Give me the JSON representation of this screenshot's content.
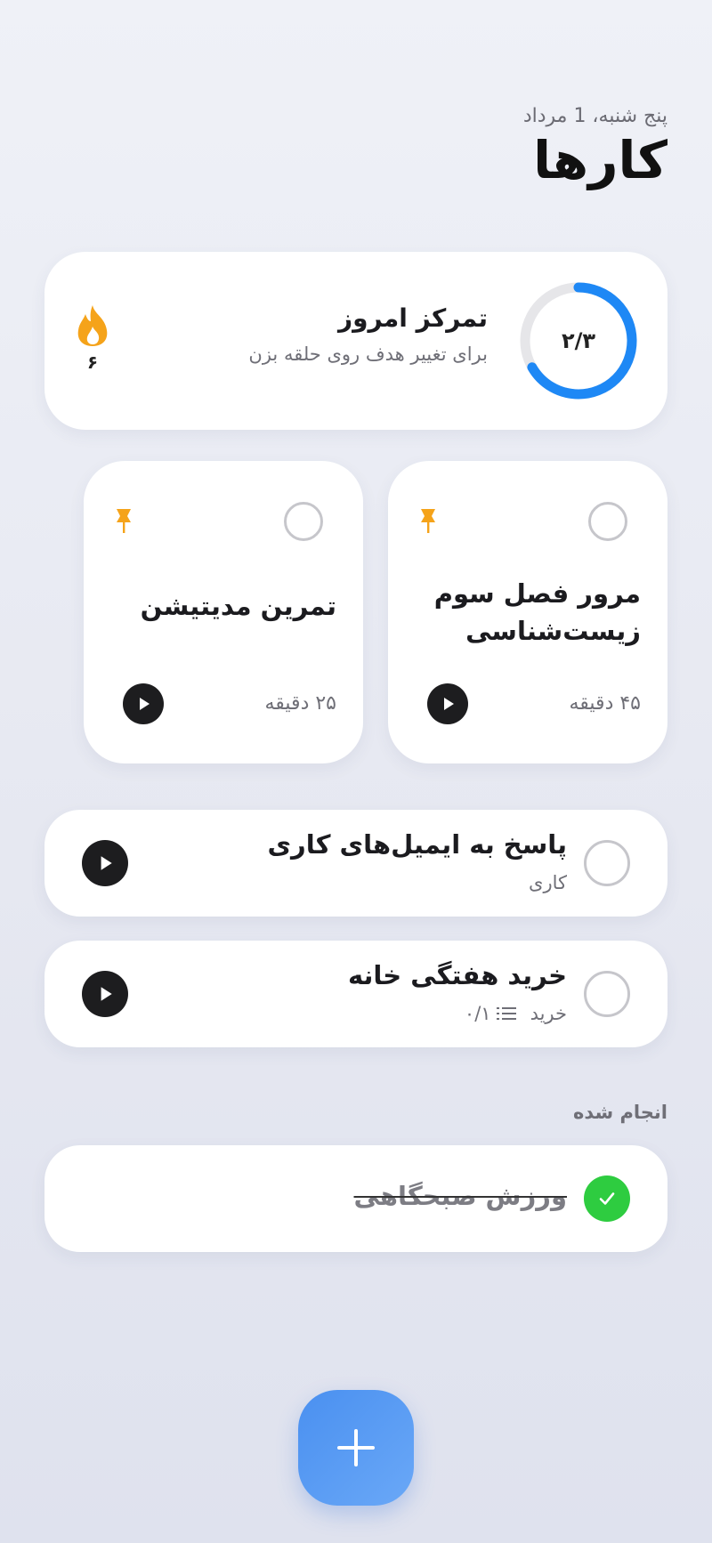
{
  "header": {
    "date": "پنج شنبه، 1 مرداد",
    "title": "کارها"
  },
  "focus": {
    "progress_label": "۲/۳",
    "progress_fraction": 0.667,
    "title": "تمرکز امروز",
    "subtitle": "برای تغییر هدف روی حلقه بزن",
    "streak_count": "۶",
    "streak_icon": "flame-icon"
  },
  "pinned": [
    {
      "title": "مرور فصل سوم زیست‌شناسی",
      "duration": "۴۵ دقیقه"
    },
    {
      "title": "تمرین مدیتیشن",
      "duration": "۲۵ دقیقه"
    }
  ],
  "tasks": [
    {
      "title": "پاسخ به ایمیل‌های کاری",
      "category": "کاری"
    },
    {
      "title": "خرید هفتگی خانه",
      "category": "خرید",
      "subtasks": "۰/۱"
    }
  ],
  "done": {
    "heading": "انجام شده",
    "items": [
      {
        "title": "ورزش صبحگاهی"
      }
    ]
  },
  "colors": {
    "accent": "#1e88f5",
    "ring_track": "#e6e6e9",
    "flame": "#f5a31a",
    "done": "#2ecc40",
    "fab": "#4a90f0"
  }
}
